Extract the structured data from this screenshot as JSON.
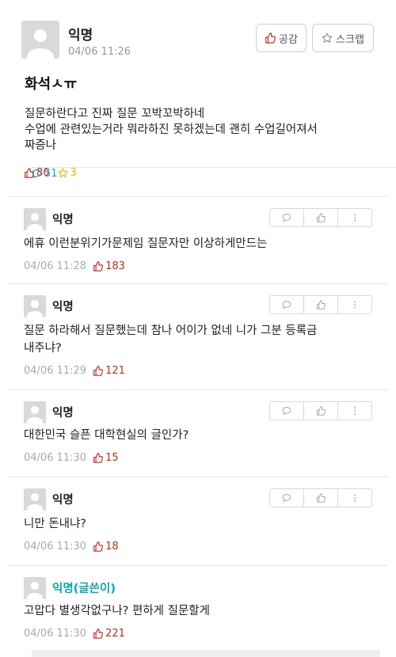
{
  "post": {
    "author": "익명",
    "time": "04/06 11:26",
    "like_button": "공감",
    "scrap_button": "스크랩",
    "title": "화석ㅅㅠ",
    "body_lines": [
      "질문하란다고 진짜 질문 꼬박꼬박하네",
      "수업에 관련있는거라 뭐라하진 못하겠는데 괜히 수업길어져서",
      "짜증나"
    ],
    "stats": {
      "votes": "80",
      "comments": "51",
      "scraps": "3"
    },
    "colors": {
      "vote": "#c62917",
      "comment": "#0ca5af",
      "scrap": "#f2b705"
    }
  },
  "comments": [
    {
      "author": "익명",
      "writer": false,
      "lines": [
        "에휴 이런분위기가문제임 질문자만 이상하게만드는"
      ],
      "time": "04/06 11:28",
      "votes": "183"
    },
    {
      "author": "익명",
      "writer": false,
      "lines": [
        "질문 하라해서 질문했는데 참나 어이가 없네 니가 그분 등록금",
        "내주냐?"
      ],
      "time": "04/06 11:29",
      "votes": "121"
    },
    {
      "author": "익명",
      "writer": false,
      "lines": [
        "대한민국 슬픈 대학현실의 글인가?"
      ],
      "time": "04/06 11:30",
      "votes": "15"
    },
    {
      "author": "익명",
      "writer": false,
      "lines": [
        "니만 돈내냐?"
      ],
      "time": "04/06 11:30",
      "votes": "18"
    },
    {
      "author": "익명(글쓴이)",
      "writer": true,
      "lines": [
        "고맙다 별생각없구나? 편하게 질문할게"
      ],
      "time": "04/06 11:30",
      "votes": "221"
    }
  ]
}
